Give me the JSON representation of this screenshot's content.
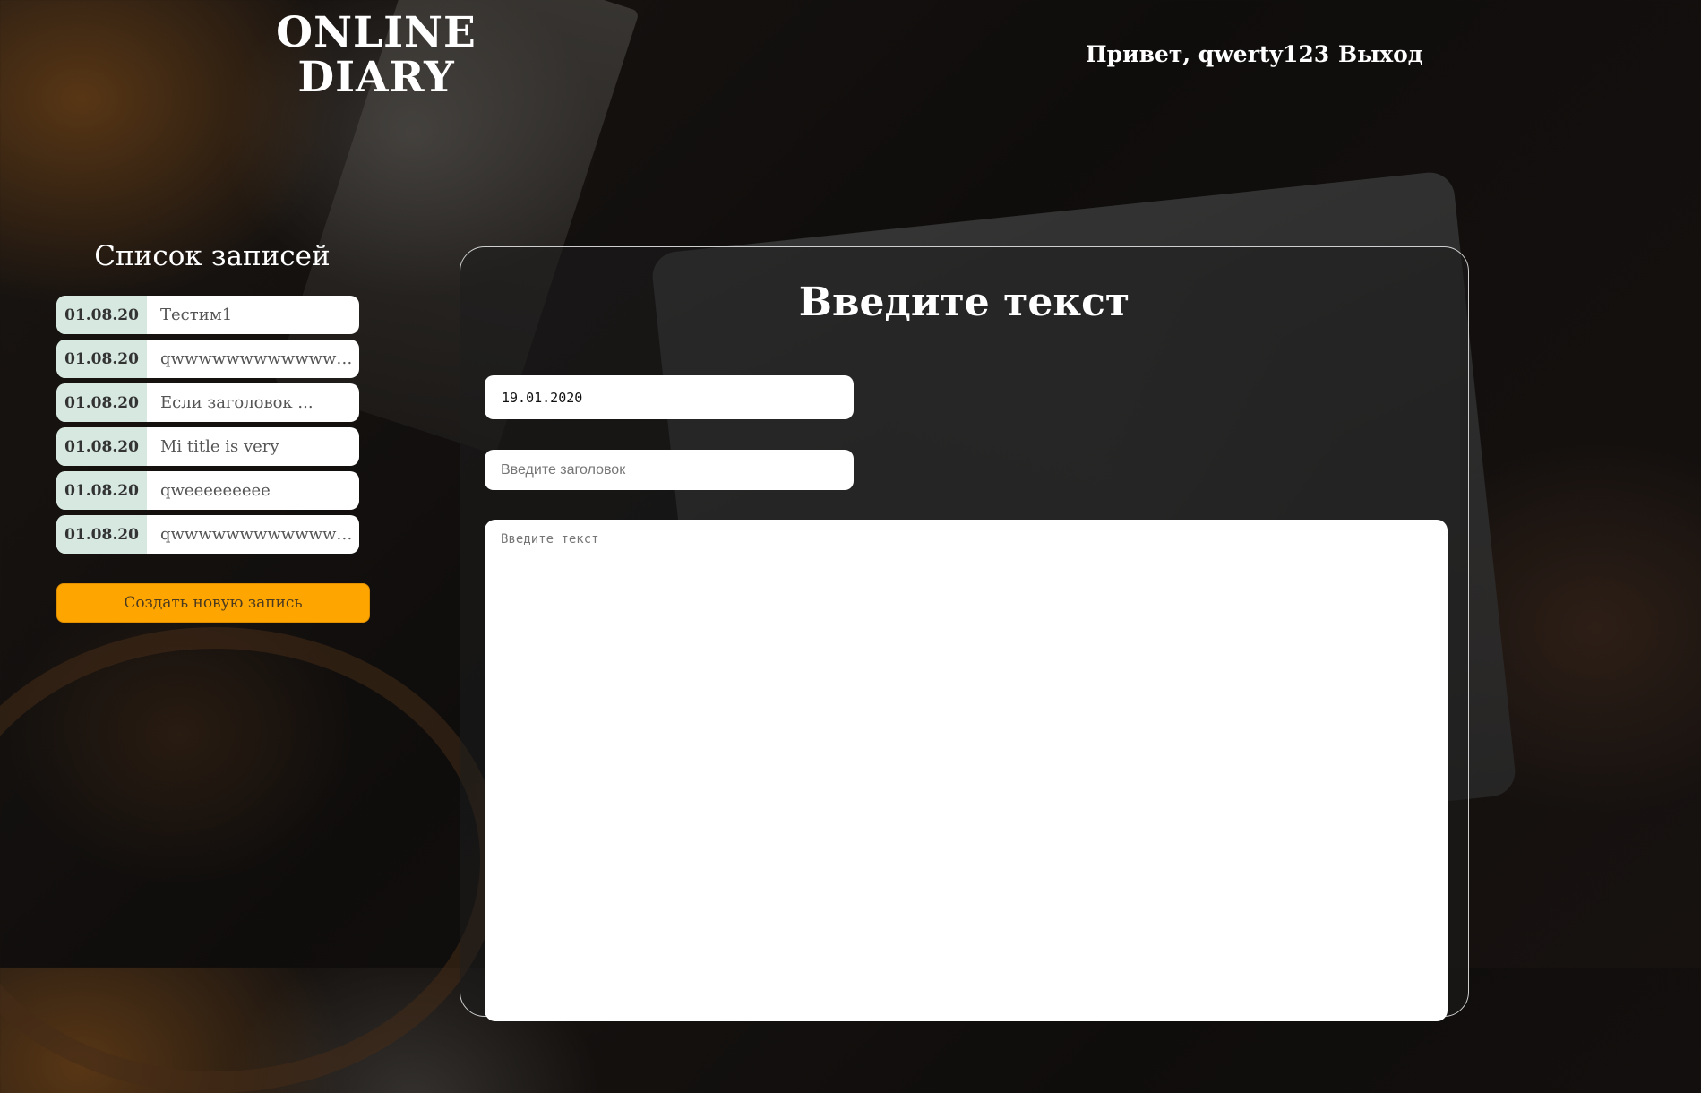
{
  "header": {
    "logo_line1": "ONLINE",
    "logo_line2": "DIARY",
    "greeting": "Привет, qwerty123",
    "logout_label": "Выход"
  },
  "sidebar": {
    "title": "Список записей",
    "entries": [
      {
        "date": "01.08.20",
        "title": "Тестим1"
      },
      {
        "date": "01.08.20",
        "title": "qwwwwwwwwwwwwwww..."
      },
      {
        "date": "01.08.20",
        "title": "Если заголовок ..."
      },
      {
        "date": "01.08.20",
        "title": "Mi title is very"
      },
      {
        "date": "01.08.20",
        "title": "qweeeeeeeee"
      },
      {
        "date": "01.08.20",
        "title": "qwwwwwwwwwwwwwww..."
      }
    ],
    "create_button_label": "Создать новую запись"
  },
  "editor": {
    "heading": "Введите текст",
    "date_value": "19.01.2020",
    "title_placeholder": "Введите заголовок",
    "text_placeholder": "Введите текст"
  },
  "colors": {
    "accent": "#ffa500",
    "entry_date_bg": "#d6e8e0"
  }
}
